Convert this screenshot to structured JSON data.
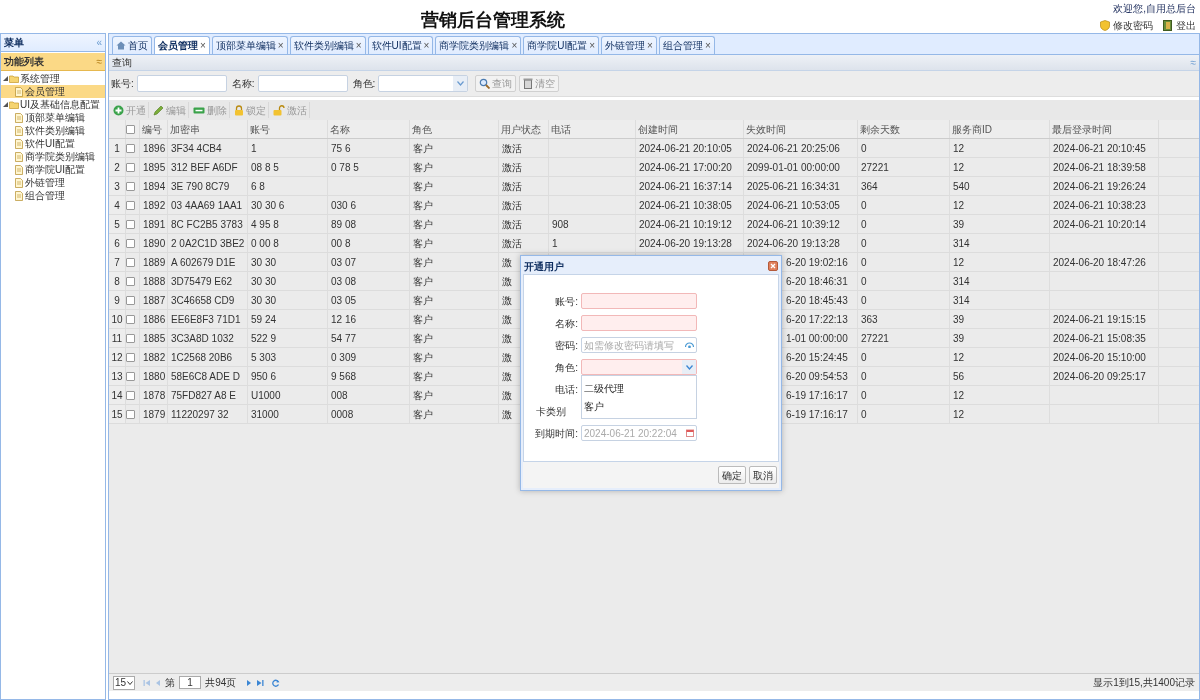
{
  "header": {
    "title": "营销后台管理系统",
    "welcome": "欢迎您,自用总后台",
    "links": [
      {
        "kind": "password",
        "label": "修改密码"
      },
      {
        "kind": "logout",
        "label": "登出"
      }
    ]
  },
  "sidebar": {
    "title": "菜单",
    "collapse": "«",
    "section": {
      "title": "功能列表",
      "expand": "≈"
    },
    "tree": [
      {
        "label": "系统管理",
        "expanded": true,
        "selected": false,
        "children": [
          {
            "label": "会员管理",
            "selected": true
          }
        ]
      },
      {
        "label": "UI及基础信息配置",
        "expanded": true,
        "selected": false,
        "children": [
          {
            "label": "顶部菜单编辑",
            "selected": false
          },
          {
            "label": "软件类别编辑",
            "selected": false
          },
          {
            "label": "软件UI配置",
            "selected": false
          },
          {
            "label": "商学院类别编辑",
            "selected": false
          },
          {
            "label": "商学院UI配置",
            "selected": false
          },
          {
            "label": "外链管理",
            "selected": false
          },
          {
            "label": "组合管理",
            "selected": false
          }
        ]
      }
    ]
  },
  "tabs": [
    {
      "label": "首页",
      "selected": false,
      "closable": false
    },
    {
      "label": "会员管理",
      "selected": true,
      "closable": true
    },
    {
      "label": "顶部菜单编辑",
      "selected": false,
      "closable": true
    },
    {
      "label": "软件类别编辑",
      "selected": false,
      "closable": true
    },
    {
      "label": "软件UI配置",
      "selected": false,
      "closable": true
    },
    {
      "label": "商学院类别编辑",
      "selected": false,
      "closable": true
    },
    {
      "label": "商学院UI配置",
      "selected": false,
      "closable": true
    },
    {
      "label": "外链管理",
      "selected": false,
      "closable": true
    },
    {
      "label": "组合管理",
      "selected": false,
      "closable": true
    }
  ],
  "close_mark": "×",
  "query": {
    "title": "查询",
    "fields": [
      {
        "label": "账号:",
        "kind": "text"
      },
      {
        "label": "名称:",
        "kind": "text"
      },
      {
        "label": "角色:",
        "kind": "combo"
      }
    ],
    "buttons": [
      {
        "kind": "search",
        "label": "查询"
      },
      {
        "kind": "clear",
        "label": "清空"
      }
    ]
  },
  "toolbar": [
    {
      "kind": "add",
      "label": "开通"
    },
    {
      "kind": "edit",
      "label": "编辑"
    },
    {
      "kind": "delete",
      "label": "删除"
    },
    {
      "kind": "lock",
      "label": "锁定"
    },
    {
      "kind": "unlock",
      "label": "激活"
    }
  ],
  "table": {
    "select_all_checked": false,
    "columns": [
      "编号",
      "加密串",
      "账号",
      "名称",
      "角色",
      "用户状态",
      "电话",
      "创建时间",
      "失效时间",
      "剩余天数",
      "服务商ID",
      "最后登录时间"
    ],
    "rows": [
      {
        "num": "1",
        "checked": false,
        "cells": [
          "1896",
          "3F34 4CB4",
          "1",
          "75 6",
          "客户",
          "激活",
          null,
          "2024-06-21 20:10:05",
          "2024-06-21 20:25:06",
          "0",
          "12",
          "2024-06-21 20:10:45"
        ]
      },
      {
        "num": "2",
        "checked": false,
        "cells": [
          "1895",
          "312 BEF A6DF",
          "08 8 5",
          "0 78 5",
          "客户",
          "激活",
          null,
          "2024-06-21 17:00:20",
          "2099-01-01 00:00:00",
          "27221",
          "12",
          "2024-06-21 18:39:58"
        ]
      },
      {
        "num": "3",
        "checked": false,
        "cells": [
          "1894",
          "3E 790 8C79",
          "6 8",
          null,
          "客户",
          "激活",
          null,
          "2024-06-21 16:37:14",
          "2025-06-21 16:34:31",
          "364",
          "540",
          "2024-06-21 19:26:24"
        ]
      },
      {
        "num": "4",
        "checked": false,
        "cells": [
          "1892",
          "03 4AA69 1AA1",
          "30 30 6",
          "030 6",
          "客户",
          "激活",
          null,
          "2024-06-21 10:38:05",
          "2024-06-21 10:53:05",
          "0",
          "12",
          "2024-06-21 10:38:23"
        ]
      },
      {
        "num": "5",
        "checked": false,
        "cells": [
          "1891",
          "8C FC2B5 3783",
          "4 95 8",
          "89 08",
          "客户",
          "激活",
          "908",
          "2024-06-21 10:19:12",
          "2024-06-21 10:39:12",
          "0",
          "39",
          "2024-06-21 10:20:14"
        ]
      },
      {
        "num": "6",
        "checked": false,
        "cells": [
          "1890",
          "2 0A2C1D 3BE2",
          "0 00 8",
          "00 8",
          "客户",
          "激活",
          "1",
          "2024-06-20 19:13:28",
          "2024-06-20 19:13:28",
          "0",
          "314",
          null
        ]
      },
      {
        "num": "7",
        "checked": false,
        "cells": [
          "1889",
          "A 602679 D1E",
          "30 30",
          "03 07",
          "客户",
          "激",
          null,
          null,
          "6-20 19:02:16",
          "0",
          "12",
          "2024-06-20 18:47:26"
        ]
      },
      {
        "num": "8",
        "checked": false,
        "cells": [
          "1888",
          "3D75479 E62",
          "30 30",
          "03 08",
          "客户",
          "激",
          null,
          null,
          "6-20 18:46:31",
          "0",
          "314",
          null
        ]
      },
      {
        "num": "9",
        "checked": false,
        "cells": [
          "1887",
          "3C46658 CD9",
          "30 30",
          "03 05",
          "客户",
          "激",
          null,
          null,
          "6-20 18:45:43",
          "0",
          "314",
          null
        ]
      },
      {
        "num": "10",
        "checked": false,
        "cells": [
          "1886",
          "EE6E8F3 71D1",
          "59 24",
          "12 16",
          "客户",
          "激",
          null,
          null,
          "6-20 17:22:13",
          "363",
          "39",
          "2024-06-21 19:15:15"
        ]
      },
      {
        "num": "11",
        "checked": false,
        "cells": [
          "1885",
          "3C3A8D 1032",
          "522 9",
          "54 77",
          "客户",
          "激",
          null,
          null,
          "1-01 00:00:00",
          "27221",
          "39",
          "2024-06-21 15:08:35"
        ]
      },
      {
        "num": "12",
        "checked": false,
        "cells": [
          "1882",
          "1C2568 20B6",
          "5 303",
          "0 309",
          "客户",
          "激",
          null,
          null,
          "6-20 15:24:45",
          "0",
          "12",
          "2024-06-20 15:10:00"
        ]
      },
      {
        "num": "13",
        "checked": false,
        "cells": [
          "1880",
          "58E6C8 ADE D",
          "950 6",
          "9 568",
          "客户",
          "激",
          null,
          null,
          "6-20 09:54:53",
          "0",
          "56",
          "2024-06-20 09:25:17"
        ]
      },
      {
        "num": "14",
        "checked": false,
        "cells": [
          "1878",
          "75FD827 A8 E",
          "U1000",
          "008",
          "客户",
          "激",
          null,
          null,
          "6-19 17:16:17",
          "0",
          "12",
          null
        ]
      },
      {
        "num": "15",
        "checked": false,
        "cells": [
          "1879",
          "11220297 32",
          "31000",
          "0008",
          "客户",
          "激",
          null,
          null,
          "6-19 17:16:17",
          "0",
          "12",
          null
        ]
      }
    ]
  },
  "pager": {
    "page_size": "15",
    "page_label": "第",
    "page": "1",
    "pages": "共94页",
    "summary": "显示1到15,共1400记录"
  },
  "dialog": {
    "title": "开通用户",
    "fields": [
      {
        "label": "账号:",
        "kind": "text",
        "invalid": true
      },
      {
        "label": "名称:",
        "kind": "text",
        "invalid": true
      },
      {
        "label": "密码:",
        "kind": "password",
        "invalid": false,
        "placeholder": "如需修改密码请填写"
      },
      {
        "label": "角色:",
        "kind": "combo",
        "invalid": true,
        "options": [
          "二级代理",
          "客户"
        ]
      },
      {
        "label": "电话:",
        "kind": "hidden"
      },
      {
        "label": "卡类别",
        "kind": "hidden"
      },
      {
        "label": "到期时间:",
        "kind": "date",
        "invalid": false,
        "value": "2024-06-21 20:22:04",
        "disabled": true
      }
    ],
    "buttons": [
      "确定",
      "取消"
    ]
  }
}
